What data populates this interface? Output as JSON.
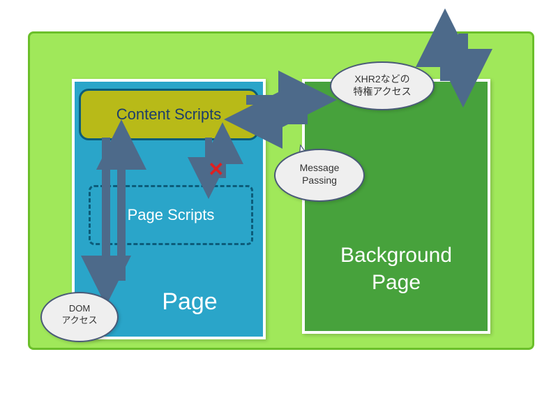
{
  "diagram": {
    "page_label": "Page",
    "content_scripts_label": "Content Scripts",
    "page_scripts_label": "Page Scripts",
    "background_page_label": "Background\nPage",
    "callouts": {
      "dom_access": "DOM\nアクセス",
      "message_passing": "Message\nPassing",
      "xhr_privileged": "XHR2などの\n特権アクセス"
    },
    "blocked_marker": "✕",
    "colors": {
      "outer_bg": "#a0e85a",
      "outer_border": "#6bbf2a",
      "page_bg": "#2aa5c9",
      "content_scripts_bg": "#b8ba18",
      "content_scripts_border": "#0c5c7a",
      "bg_page_bg": "#47a23c",
      "arrow": "#4d6a8a",
      "x_mark": "#e02020"
    }
  }
}
